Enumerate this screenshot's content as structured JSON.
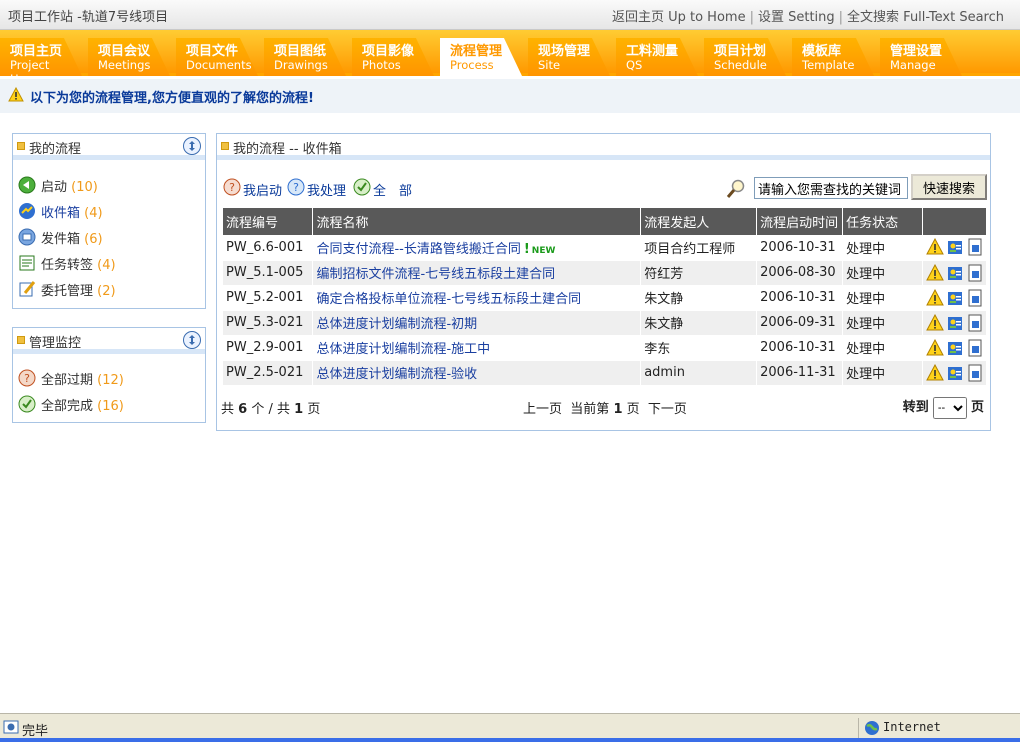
{
  "header": {
    "title": "项目工作站 -轨道7号线项目",
    "home_link": "返回主页 Up to Home",
    "setting_link": "设置 Setting",
    "search_link": "全文搜索 Full-Text Search"
  },
  "nav": {
    "tabs": [
      {
        "zh": "项目主页",
        "en": "Project Home"
      },
      {
        "zh": "项目会议",
        "en": "Meetings"
      },
      {
        "zh": "项目文件",
        "en": "Documents"
      },
      {
        "zh": "项目图纸",
        "en": "Drawings"
      },
      {
        "zh": "项目影像",
        "en": "Photos"
      },
      {
        "zh": "流程管理",
        "en": "Process"
      },
      {
        "zh": "现场管理",
        "en": "Site"
      },
      {
        "zh": "工料测量",
        "en": "QS"
      },
      {
        "zh": "项目计划",
        "en": "Schedule"
      },
      {
        "zh": "模板库",
        "en": "Template"
      },
      {
        "zh": "管理设置",
        "en": "Manage"
      }
    ],
    "active_tab": "流程管理"
  },
  "notice": {
    "text": "以下为您的流程管理,您方便直观的了解您的流程!"
  },
  "sidebar": {
    "my_process": {
      "title": "我的流程",
      "items": [
        {
          "label": "启动",
          "count": "(10)",
          "icon": "start-icon"
        },
        {
          "label": "收件箱",
          "count": "(4)",
          "icon": "inbox-icon"
        },
        {
          "label": "发件箱",
          "count": "(6)",
          "icon": "outbox-icon"
        },
        {
          "label": "任务转签",
          "count": "(4)",
          "icon": "task-transfer-icon"
        },
        {
          "label": "委托管理",
          "count": "(2)",
          "icon": "delegate-icon"
        }
      ]
    },
    "monitor": {
      "title": "管理监控",
      "items": [
        {
          "label": "全部过期",
          "count": "(12)",
          "icon": "overdue-icon"
        },
        {
          "label": "全部完成",
          "count": "(16)",
          "icon": "completed-icon"
        }
      ]
    }
  },
  "main": {
    "title": "我的流程 -- 收件箱",
    "actions": {
      "started": "我启动",
      "handled": "我处理",
      "all": "全　部"
    },
    "search": {
      "value": "请输入您需查找的关键词",
      "button": "快速搜索"
    },
    "columns": [
      "流程编号",
      "流程名称",
      "流程发起人",
      "流程启动时间",
      "任务状态"
    ],
    "rows": [
      {
        "id": "PW_6.6-001",
        "name": "合同支付流程--长清路管线搬迁合同",
        "initiator": "项目合约工程师",
        "date": "2006-10-31",
        "status": "处理中",
        "is_new": true,
        "new_label": "NEW"
      },
      {
        "id": "PW_5.1-005",
        "name": "编制招标文件流程-七号线五标段土建合同",
        "initiator": "符红芳",
        "date": "2006-08-30",
        "status": "处理中",
        "is_new": false
      },
      {
        "id": "PW_5.2-001",
        "name": "确定合格投标单位流程-七号线五标段土建合同",
        "initiator": "朱文静",
        "date": "2006-10-31",
        "status": "处理中",
        "is_new": false
      },
      {
        "id": "PW_5.3-021",
        "name": "总体进度计划编制流程-初期",
        "initiator": "朱文静",
        "date": "2006-09-31",
        "status": "处理中",
        "is_new": false
      },
      {
        "id": "PW_2.9-001",
        "name": "总体进度计划编制流程-施工中",
        "initiator": "李东",
        "date": "2006-10-31",
        "status": "处理中",
        "is_new": false
      },
      {
        "id": "PW_2.5-021",
        "name": "总体进度计划编制流程-验收",
        "initiator": "admin",
        "date": "2006-11-31",
        "status": "处理中",
        "is_new": false
      }
    ],
    "pager": {
      "total_prefix": "共",
      "total_count": "6",
      "total_mid": "个 / 共",
      "total_pages": "1",
      "total_suffix": "页",
      "prev": "上一页",
      "current_prefix": "当前第",
      "current_page": "1",
      "current_suffix": "页",
      "next": "下一页",
      "goto": "转到",
      "goto_value": "--",
      "goto_suffix": "页"
    }
  },
  "statusbar": {
    "status": "完毕",
    "zone": "Internet"
  },
  "colors": {
    "nav_orange": "#ff9900",
    "link_blue": "#1a3fa0",
    "count_orange": "#f09a1a",
    "header_gray": "#595959"
  }
}
